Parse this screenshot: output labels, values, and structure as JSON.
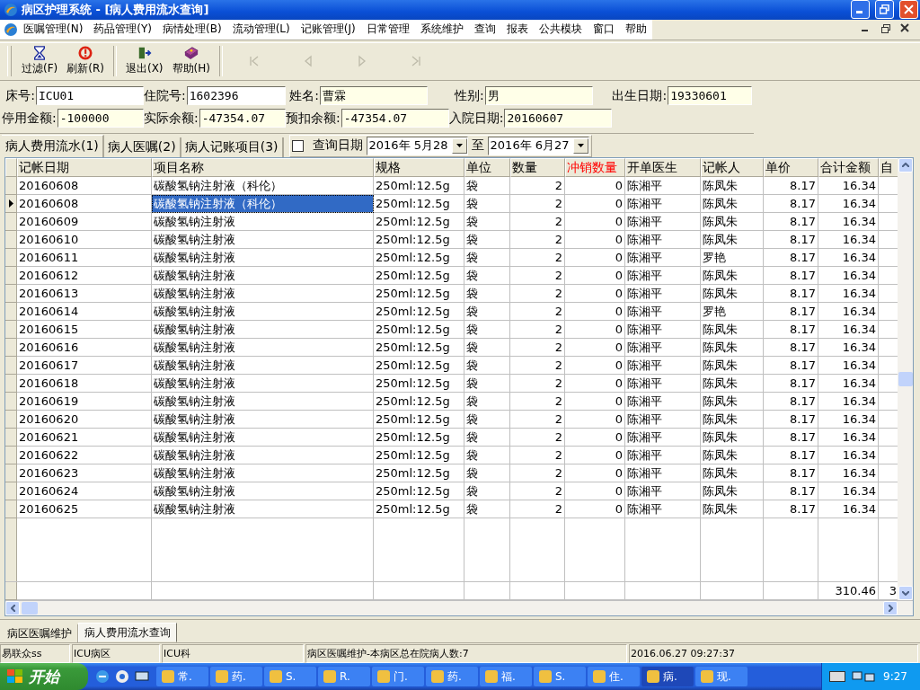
{
  "window": {
    "title": "病区护理系统 - [病人费用流水查询]"
  },
  "menu": [
    {
      "label": "医嘱管理(N)"
    },
    {
      "label": "药品管理(Y)"
    },
    {
      "label": "病情处理(B)"
    },
    {
      "label": "流动管理(L)"
    },
    {
      "label": "记账管理(J)"
    },
    {
      "label": "日常管理"
    },
    {
      "label": "系统维护"
    },
    {
      "label": "查询"
    },
    {
      "label": "报表"
    },
    {
      "label": "公共模块"
    },
    {
      "label": "窗口"
    },
    {
      "label": "帮助"
    }
  ],
  "toolbar": [
    {
      "kind": "filter",
      "label": "过滤(F)"
    },
    {
      "kind": "refresh",
      "label": "刷新(R)"
    },
    {
      "kind": "exit",
      "label": "退出(X)"
    },
    {
      "kind": "help",
      "label": "帮助(H)"
    }
  ],
  "navigation": [
    {
      "kind": "first",
      "disabled": true
    },
    {
      "kind": "previous",
      "disabled": true
    },
    {
      "kind": "next",
      "disabled": true
    },
    {
      "kind": "last",
      "disabled": true
    }
  ],
  "patient": [
    {
      "label": "床号:",
      "value": "ICU01"
    },
    {
      "label": "住院号:",
      "value": "1602396"
    },
    {
      "label": "姓名:",
      "value": "曹霖"
    },
    {
      "label": "性别:",
      "value": "男"
    },
    {
      "label": "出生日期:",
      "value": "19330601"
    },
    {
      "label": "停用金额:",
      "value": "-100000"
    },
    {
      "label": "实际余额:",
      "value": "-47354.07"
    },
    {
      "label": "预扣余额:",
      "value": "-47354.07"
    },
    {
      "label": "入院日期:",
      "value": "20160607"
    }
  ],
  "tabs": [
    {
      "label": "病人费用流水(1)",
      "selected": true
    },
    {
      "label": "病人医嘱(2)",
      "selected": false
    },
    {
      "label": "病人记账项目(3)",
      "selected": false
    }
  ],
  "query": {
    "checked": false,
    "label": "查询日期",
    "from": "2016年 5月28",
    "separator": "至",
    "to": "2016年 6月27"
  },
  "table": {
    "columns": [
      {
        "label": "记帐日期",
        "kind": "text",
        "highlighted": false,
        "current": false
      },
      {
        "label": "项目名称",
        "kind": "text",
        "highlighted": false,
        "current": true
      },
      {
        "label": "规格",
        "kind": "text",
        "highlighted": false,
        "current": false
      },
      {
        "label": "单位",
        "kind": "text",
        "highlighted": false,
        "current": false
      },
      {
        "label": "数量",
        "kind": "number",
        "highlighted": false,
        "current": false
      },
      {
        "label": "冲销数量",
        "kind": "number",
        "highlighted": true,
        "current": false
      },
      {
        "label": "开单医生",
        "kind": "text",
        "highlighted": false,
        "current": false
      },
      {
        "label": "记帐人",
        "kind": "text",
        "highlighted": false,
        "current": false
      },
      {
        "label": "单价",
        "kind": "number",
        "highlighted": false,
        "current": false
      },
      {
        "label": "合计金额",
        "kind": "number",
        "highlighted": false,
        "current": false
      },
      {
        "label": "自",
        "kind": "text",
        "highlighted": false,
        "current": false
      }
    ],
    "rows": [
      {
        "selected": false,
        "cells": [
          "20160608",
          "碳酸氢钠注射液（科伦）",
          "250ml:12.5g",
          "袋",
          "2",
          "0",
          "陈湘平",
          "陈凤朱",
          "8.17",
          "16.34"
        ]
      },
      {
        "selected": true,
        "cells": [
          "20160608",
          "碳酸氢钠注射液（科伦）",
          "250ml:12.5g",
          "袋",
          "2",
          "0",
          "陈湘平",
          "陈凤朱",
          "8.17",
          "16.34"
        ]
      },
      {
        "selected": false,
        "cells": [
          "20160609",
          "碳酸氢钠注射液",
          "250ml:12.5g",
          "袋",
          "2",
          "0",
          "陈湘平",
          "陈凤朱",
          "8.17",
          "16.34"
        ]
      },
      {
        "selected": false,
        "cells": [
          "20160610",
          "碳酸氢钠注射液",
          "250ml:12.5g",
          "袋",
          "2",
          "0",
          "陈湘平",
          "陈凤朱",
          "8.17",
          "16.34"
        ]
      },
      {
        "selected": false,
        "cells": [
          "20160611",
          "碳酸氢钠注射液",
          "250ml:12.5g",
          "袋",
          "2",
          "0",
          "陈湘平",
          "罗艳",
          "8.17",
          "16.34"
        ]
      },
      {
        "selected": false,
        "cells": [
          "20160612",
          "碳酸氢钠注射液",
          "250ml:12.5g",
          "袋",
          "2",
          "0",
          "陈湘平",
          "陈凤朱",
          "8.17",
          "16.34"
        ]
      },
      {
        "selected": false,
        "cells": [
          "20160613",
          "碳酸氢钠注射液",
          "250ml:12.5g",
          "袋",
          "2",
          "0",
          "陈湘平",
          "陈凤朱",
          "8.17",
          "16.34"
        ]
      },
      {
        "selected": false,
        "cells": [
          "20160614",
          "碳酸氢钠注射液",
          "250ml:12.5g",
          "袋",
          "2",
          "0",
          "陈湘平",
          "罗艳",
          "8.17",
          "16.34"
        ]
      },
      {
        "selected": false,
        "cells": [
          "20160615",
          "碳酸氢钠注射液",
          "250ml:12.5g",
          "袋",
          "2",
          "0",
          "陈湘平",
          "陈凤朱",
          "8.17",
          "16.34"
        ]
      },
      {
        "selected": false,
        "cells": [
          "20160616",
          "碳酸氢钠注射液",
          "250ml:12.5g",
          "袋",
          "2",
          "0",
          "陈湘平",
          "陈凤朱",
          "8.17",
          "16.34"
        ]
      },
      {
        "selected": false,
        "cells": [
          "20160617",
          "碳酸氢钠注射液",
          "250ml:12.5g",
          "袋",
          "2",
          "0",
          "陈湘平",
          "陈凤朱",
          "8.17",
          "16.34"
        ]
      },
      {
        "selected": false,
        "cells": [
          "20160618",
          "碳酸氢钠注射液",
          "250ml:12.5g",
          "袋",
          "2",
          "0",
          "陈湘平",
          "陈凤朱",
          "8.17",
          "16.34"
        ]
      },
      {
        "selected": false,
        "cells": [
          "20160619",
          "碳酸氢钠注射液",
          "250ml:12.5g",
          "袋",
          "2",
          "0",
          "陈湘平",
          "陈凤朱",
          "8.17",
          "16.34"
        ]
      },
      {
        "selected": false,
        "cells": [
          "20160620",
          "碳酸氢钠注射液",
          "250ml:12.5g",
          "袋",
          "2",
          "0",
          "陈湘平",
          "陈凤朱",
          "8.17",
          "16.34"
        ]
      },
      {
        "selected": false,
        "cells": [
          "20160621",
          "碳酸氢钠注射液",
          "250ml:12.5g",
          "袋",
          "2",
          "0",
          "陈湘平",
          "陈凤朱",
          "8.17",
          "16.34"
        ]
      },
      {
        "selected": false,
        "cells": [
          "20160622",
          "碳酸氢钠注射液",
          "250ml:12.5g",
          "袋",
          "2",
          "0",
          "陈湘平",
          "陈凤朱",
          "8.17",
          "16.34"
        ]
      },
      {
        "selected": false,
        "cells": [
          "20160623",
          "碳酸氢钠注射液",
          "250ml:12.5g",
          "袋",
          "2",
          "0",
          "陈湘平",
          "陈凤朱",
          "8.17",
          "16.34"
        ]
      },
      {
        "selected": false,
        "cells": [
          "20160624",
          "碳酸氢钠注射液",
          "250ml:12.5g",
          "袋",
          "2",
          "0",
          "陈湘平",
          "陈凤朱",
          "8.17",
          "16.34"
        ]
      },
      {
        "selected": false,
        "cells": [
          "20160625",
          "碳酸氢钠注射液",
          "250ml:12.5g",
          "袋",
          "2",
          "0",
          "陈湘平",
          "陈凤朱",
          "8.17",
          "16.34"
        ]
      }
    ],
    "footer": {
      "total_amount": "310.46",
      "column_11": "3"
    }
  },
  "bottom_tabs": [
    {
      "label": "病区医嘱维护",
      "selected": false
    },
    {
      "label": "病人费用流水查询",
      "selected": true
    }
  ],
  "status_bar": [
    "易联众ss",
    "ICU病区",
    "ICU科",
    "病区医嘱维护-本病区总在院病人数:7",
    "2016.06.27 09:27:37"
  ],
  "taskbar": {
    "start": "开始",
    "tasks": [
      {
        "label": "常.",
        "selected": false
      },
      {
        "label": "药.",
        "selected": false
      },
      {
        "label": "S.",
        "selected": false
      },
      {
        "label": "R.",
        "selected": false
      },
      {
        "label": "门.",
        "selected": false
      },
      {
        "label": "药.",
        "selected": false
      },
      {
        "label": "福.",
        "selected": false
      },
      {
        "label": "S.",
        "selected": false
      },
      {
        "label": "住.",
        "selected": false
      },
      {
        "label": "病.",
        "selected": true
      },
      {
        "label": "现.",
        "selected": false
      }
    ],
    "clock": "9:27"
  }
}
